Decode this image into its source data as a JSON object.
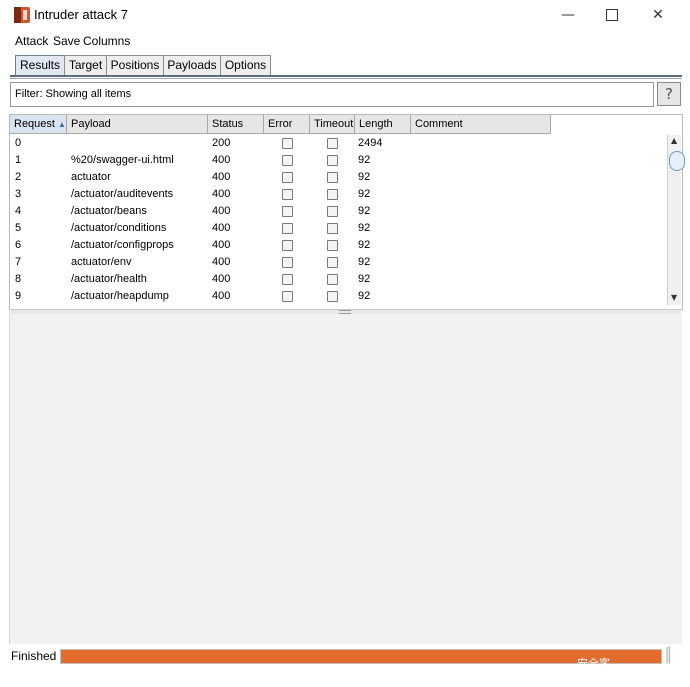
{
  "window": {
    "title": "Intruder attack 7"
  },
  "menu": [
    "Attack",
    "Save",
    "Columns"
  ],
  "tabs": [
    "Results",
    "Target",
    "Positions",
    "Payloads",
    "Options"
  ],
  "filter": {
    "text": "Filter: Showing all items",
    "help": "?"
  },
  "table": {
    "columns": [
      "Request",
      "Payload",
      "Status",
      "Error",
      "Timeout",
      "Length",
      "Comment"
    ],
    "rows": [
      {
        "request": "0",
        "payload": "",
        "status": "200",
        "length": "2494"
      },
      {
        "request": "1",
        "payload": "%20/swagger-ui.html",
        "status": "400",
        "length": "92"
      },
      {
        "request": "2",
        "payload": "actuator",
        "status": "400",
        "length": "92"
      },
      {
        "request": "3",
        "payload": "/actuator/auditevents",
        "status": "400",
        "length": "92"
      },
      {
        "request": "4",
        "payload": "/actuator/beans",
        "status": "400",
        "length": "92"
      },
      {
        "request": "5",
        "payload": "/actuator/conditions",
        "status": "400",
        "length": "92"
      },
      {
        "request": "6",
        "payload": "/actuator/configprops",
        "status": "400",
        "length": "92"
      },
      {
        "request": "7",
        "payload": "actuator/env",
        "status": "400",
        "length": "92"
      },
      {
        "request": "8",
        "payload": "/actuator/health",
        "status": "400",
        "length": "92"
      },
      {
        "request": "9",
        "payload": "/actuator/heapdump",
        "status": "400",
        "length": "92"
      }
    ]
  },
  "status": {
    "text": "Finished",
    "progress": 1.0,
    "watermark": "安全客（www.anquanke.com）"
  },
  "colors": {
    "progress": "#e36b2c",
    "active_tab": "#dfe8f3"
  },
  "icons": {
    "app": "burp-icon",
    "minimize": "minimize-icon",
    "maximize": "maximize-icon",
    "close": "close-icon"
  }
}
